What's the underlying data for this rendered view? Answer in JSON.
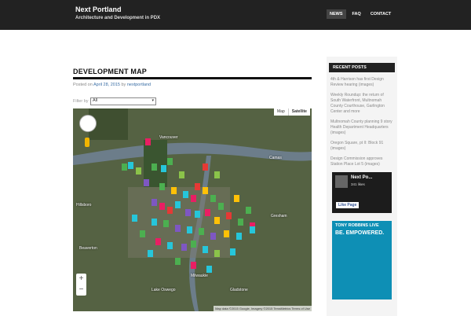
{
  "site": {
    "title": "Next Portland",
    "subtitle": "Architecture and Development in PDX"
  },
  "nav": [
    {
      "label": "NEWS",
      "active": true
    },
    {
      "label": "FAQ",
      "active": false
    },
    {
      "label": "CONTACT",
      "active": false
    }
  ],
  "post": {
    "title": "DEVELOPMENT MAP",
    "posted_on": "Posted on",
    "date": "April 28, 2015",
    "by": "by",
    "author": "nextportland"
  },
  "filter": {
    "label": "Filter by",
    "value": "All"
  },
  "map": {
    "toggle": {
      "map": "Map",
      "satellite": "Satellite"
    },
    "zoom_in": "+",
    "zoom_out": "−",
    "attribution": "Map data ©2015 Google, Imagery ©2015 TerraMetrics   Terms of Use",
    "labels": [
      {
        "text": "Vancouver"
      },
      {
        "text": "Beaverton"
      },
      {
        "text": "Gresham"
      },
      {
        "text": "Gladstone"
      },
      {
        "text": "Milwaukie"
      },
      {
        "text": "Lake Oswego"
      },
      {
        "text": "Hillsboro"
      },
      {
        "text": "Camas"
      }
    ]
  },
  "sidebar": {
    "recent_title": "RECENT POSTS",
    "recent_posts": [
      "4th & Harrison has first Design Review hearing (images)",
      "Weekly Roundup: the return of South Waterfront, Multnomah County Courthouse, Garlington Center and more",
      "Multnomah County planning 9 story Health Department Headquarters (images)",
      "Oregon Square, pt II: Block 91 (images)",
      "Design Commission approves Station Place Lot 5 (images)"
    ],
    "fb": {
      "name": "Next Po...",
      "likes": "341 likes",
      "button": "Like Page"
    },
    "ad": {
      "line1": "TONY ROBBINS LIVE",
      "line2": "BE. EMPOWERED."
    }
  }
}
